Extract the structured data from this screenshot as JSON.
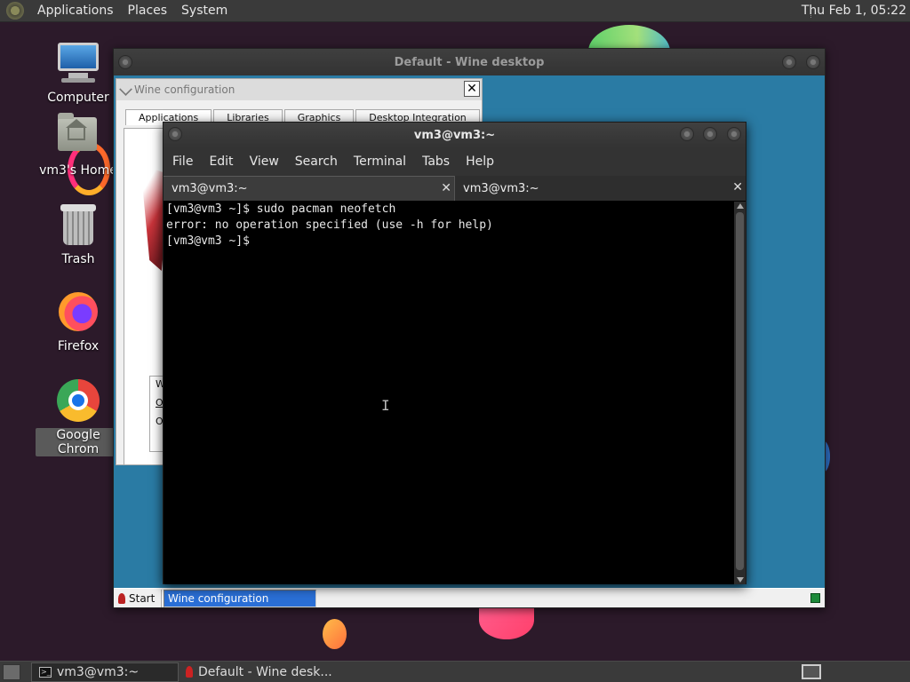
{
  "top_panel": {
    "menus": [
      "Applications",
      "Places",
      "System"
    ],
    "clock": "Thu Feb  1, 05:22"
  },
  "desktop": {
    "icons": [
      {
        "label": "Computer",
        "icon": "computer-icon"
      },
      {
        "label": "vm3's Home",
        "icon": "home-folder-icon"
      },
      {
        "label": "Trash",
        "icon": "trash-icon"
      },
      {
        "label": "Firefox",
        "icon": "firefox-icon"
      },
      {
        "label": "Google Chrom",
        "icon": "chrome-icon"
      }
    ]
  },
  "wine_desktop": {
    "title": "Default - Wine desktop",
    "taskbar": {
      "start_label": "Start",
      "task_label": "Wine configuration"
    }
  },
  "winecfg": {
    "title": "Wine configuration",
    "close_glyph": "✕",
    "tabs": [
      "Applications",
      "Libraries",
      "Graphics",
      "Desktop Integration"
    ],
    "group_label": "W",
    "group_items": [
      "O",
      "O"
    ]
  },
  "terminal": {
    "title": "vm3@vm3:~",
    "menu": [
      "File",
      "Edit",
      "View",
      "Search",
      "Terminal",
      "Tabs",
      "Help"
    ],
    "tabs": [
      {
        "label": "vm3@vm3:~"
      },
      {
        "label": "vm3@vm3:~"
      }
    ],
    "close_glyph": "✕",
    "lines": [
      "[vm3@vm3 ~]$ sudo pacman neofetch",
      "error: no operation specified (use -h for help)",
      "[vm3@vm3 ~]$ "
    ],
    "cursor_glyph": "I"
  },
  "bottom_panel": {
    "tasks": [
      {
        "label": "vm3@vm3:~",
        "icon": "terminal-icon"
      },
      {
        "label": "Default - Wine desk...",
        "icon": "wine-icon"
      }
    ]
  }
}
